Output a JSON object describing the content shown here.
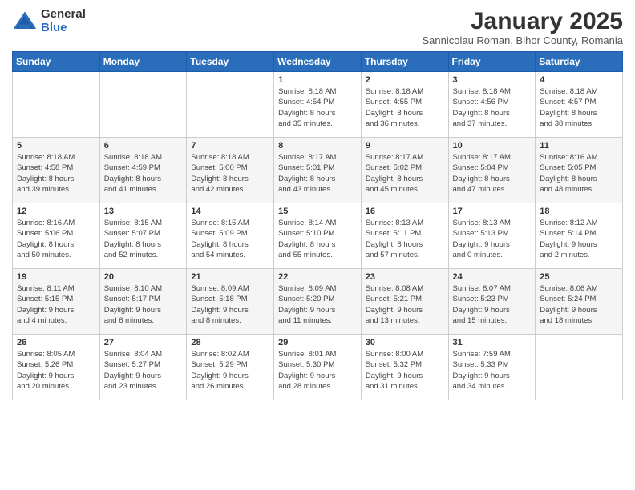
{
  "logo": {
    "general": "General",
    "blue": "Blue"
  },
  "header": {
    "title": "January 2025",
    "subtitle": "Sannicolau Roman, Bihor County, Romania"
  },
  "weekdays": [
    "Sunday",
    "Monday",
    "Tuesday",
    "Wednesday",
    "Thursday",
    "Friday",
    "Saturday"
  ],
  "weeks": [
    [
      {
        "day": "",
        "info": ""
      },
      {
        "day": "",
        "info": ""
      },
      {
        "day": "",
        "info": ""
      },
      {
        "day": "1",
        "info": "Sunrise: 8:18 AM\nSunset: 4:54 PM\nDaylight: 8 hours\nand 35 minutes."
      },
      {
        "day": "2",
        "info": "Sunrise: 8:18 AM\nSunset: 4:55 PM\nDaylight: 8 hours\nand 36 minutes."
      },
      {
        "day": "3",
        "info": "Sunrise: 8:18 AM\nSunset: 4:56 PM\nDaylight: 8 hours\nand 37 minutes."
      },
      {
        "day": "4",
        "info": "Sunrise: 8:18 AM\nSunset: 4:57 PM\nDaylight: 8 hours\nand 38 minutes."
      }
    ],
    [
      {
        "day": "5",
        "info": "Sunrise: 8:18 AM\nSunset: 4:58 PM\nDaylight: 8 hours\nand 39 minutes."
      },
      {
        "day": "6",
        "info": "Sunrise: 8:18 AM\nSunset: 4:59 PM\nDaylight: 8 hours\nand 41 minutes."
      },
      {
        "day": "7",
        "info": "Sunrise: 8:18 AM\nSunset: 5:00 PM\nDaylight: 8 hours\nand 42 minutes."
      },
      {
        "day": "8",
        "info": "Sunrise: 8:17 AM\nSunset: 5:01 PM\nDaylight: 8 hours\nand 43 minutes."
      },
      {
        "day": "9",
        "info": "Sunrise: 8:17 AM\nSunset: 5:02 PM\nDaylight: 8 hours\nand 45 minutes."
      },
      {
        "day": "10",
        "info": "Sunrise: 8:17 AM\nSunset: 5:04 PM\nDaylight: 8 hours\nand 47 minutes."
      },
      {
        "day": "11",
        "info": "Sunrise: 8:16 AM\nSunset: 5:05 PM\nDaylight: 8 hours\nand 48 minutes."
      }
    ],
    [
      {
        "day": "12",
        "info": "Sunrise: 8:16 AM\nSunset: 5:06 PM\nDaylight: 8 hours\nand 50 minutes."
      },
      {
        "day": "13",
        "info": "Sunrise: 8:15 AM\nSunset: 5:07 PM\nDaylight: 8 hours\nand 52 minutes."
      },
      {
        "day": "14",
        "info": "Sunrise: 8:15 AM\nSunset: 5:09 PM\nDaylight: 8 hours\nand 54 minutes."
      },
      {
        "day": "15",
        "info": "Sunrise: 8:14 AM\nSunset: 5:10 PM\nDaylight: 8 hours\nand 55 minutes."
      },
      {
        "day": "16",
        "info": "Sunrise: 8:13 AM\nSunset: 5:11 PM\nDaylight: 8 hours\nand 57 minutes."
      },
      {
        "day": "17",
        "info": "Sunrise: 8:13 AM\nSunset: 5:13 PM\nDaylight: 9 hours\nand 0 minutes."
      },
      {
        "day": "18",
        "info": "Sunrise: 8:12 AM\nSunset: 5:14 PM\nDaylight: 9 hours\nand 2 minutes."
      }
    ],
    [
      {
        "day": "19",
        "info": "Sunrise: 8:11 AM\nSunset: 5:15 PM\nDaylight: 9 hours\nand 4 minutes."
      },
      {
        "day": "20",
        "info": "Sunrise: 8:10 AM\nSunset: 5:17 PM\nDaylight: 9 hours\nand 6 minutes."
      },
      {
        "day": "21",
        "info": "Sunrise: 8:09 AM\nSunset: 5:18 PM\nDaylight: 9 hours\nand 8 minutes."
      },
      {
        "day": "22",
        "info": "Sunrise: 8:09 AM\nSunset: 5:20 PM\nDaylight: 9 hours\nand 11 minutes."
      },
      {
        "day": "23",
        "info": "Sunrise: 8:08 AM\nSunset: 5:21 PM\nDaylight: 9 hours\nand 13 minutes."
      },
      {
        "day": "24",
        "info": "Sunrise: 8:07 AM\nSunset: 5:23 PM\nDaylight: 9 hours\nand 15 minutes."
      },
      {
        "day": "25",
        "info": "Sunrise: 8:06 AM\nSunset: 5:24 PM\nDaylight: 9 hours\nand 18 minutes."
      }
    ],
    [
      {
        "day": "26",
        "info": "Sunrise: 8:05 AM\nSunset: 5:26 PM\nDaylight: 9 hours\nand 20 minutes."
      },
      {
        "day": "27",
        "info": "Sunrise: 8:04 AM\nSunset: 5:27 PM\nDaylight: 9 hours\nand 23 minutes."
      },
      {
        "day": "28",
        "info": "Sunrise: 8:02 AM\nSunset: 5:29 PM\nDaylight: 9 hours\nand 26 minutes."
      },
      {
        "day": "29",
        "info": "Sunrise: 8:01 AM\nSunset: 5:30 PM\nDaylight: 9 hours\nand 28 minutes."
      },
      {
        "day": "30",
        "info": "Sunrise: 8:00 AM\nSunset: 5:32 PM\nDaylight: 9 hours\nand 31 minutes."
      },
      {
        "day": "31",
        "info": "Sunrise: 7:59 AM\nSunset: 5:33 PM\nDaylight: 9 hours\nand 34 minutes."
      },
      {
        "day": "",
        "info": ""
      }
    ]
  ]
}
